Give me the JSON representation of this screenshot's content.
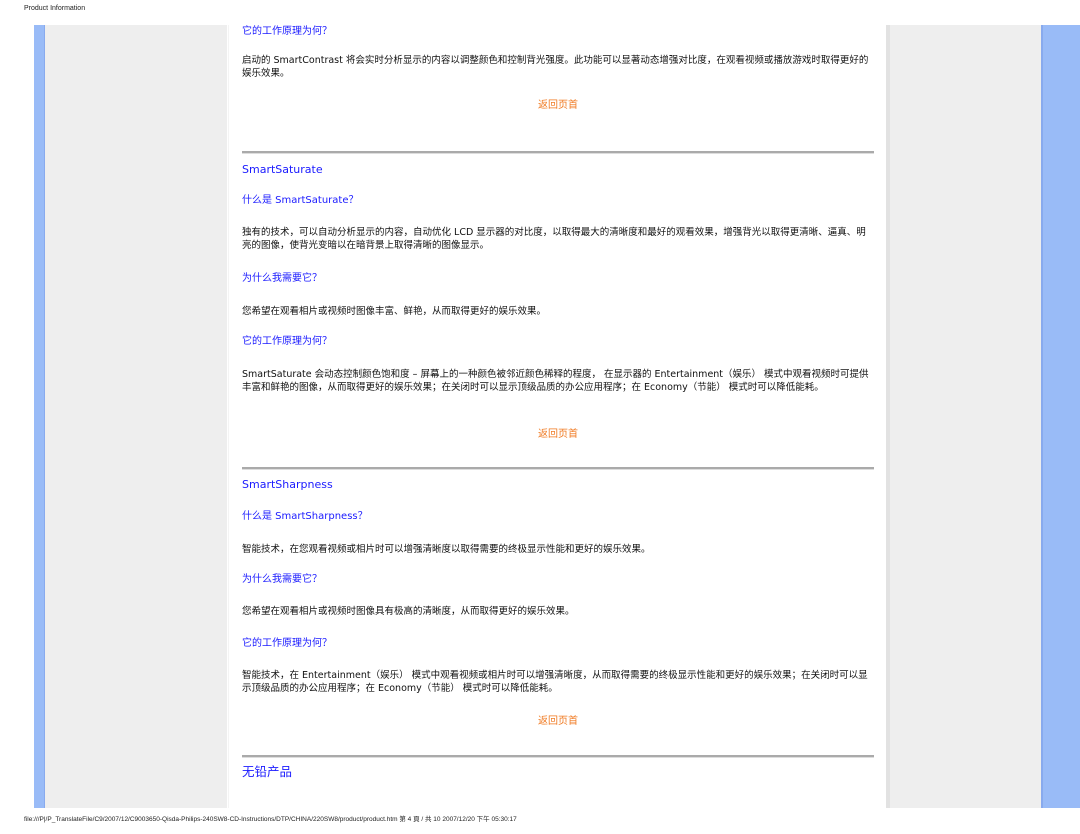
{
  "header": {
    "title": "Product Information"
  },
  "sections": {
    "contrast_tail": {
      "how_heading": "它的工作原理为何？",
      "how_text": "启动的 SmartContrast 将会实时分析显示的内容以调整颜色和控制背光强度。此功能可以显著动态增强对比度，在观看视频或播放游戏时取得更好的娱乐效果。",
      "back_to_top": "返回页首"
    },
    "saturate": {
      "title": "SmartSaturate",
      "what_heading": "什么是 SmartSaturate？",
      "what_text": "独有的技术，可以自动分析显示的内容，自动优化 LCD 显示器的对比度，以取得最大的清晰度和最好的观看效果，增强背光以取得更清晰、逼真、明亮的图像，使背光变暗以在暗背景上取得清晰的图像显示。",
      "why_heading": "为什么我需要它？",
      "why_text": "您希望在观看相片或视频时图像丰富、鲜艳，从而取得更好的娱乐效果。",
      "how_heading": "它的工作原理为何？",
      "how_text": "SmartSaturate 会动态控制颜色饱和度 – 屏幕上的一种颜色被邻近颜色稀释的程度， 在显示器的 Entertainment（娱乐） 模式中观看视频时可提供丰富和鲜艳的图像，从而取得更好的娱乐效果；在关闭时可以显示顶级品质的办公应用程序；在 Economy（节能） 模式时可以降低能耗。",
      "back_to_top": "返回页首"
    },
    "sharpness": {
      "title": "SmartSharpness",
      "what_heading": "什么是 SmartSharpness？",
      "what_text": "智能技术，在您观看视频或相片时可以增强清晰度以取得需要的终极显示性能和更好的娱乐效果。",
      "why_heading": "为什么我需要它？",
      "why_text": "您希望在观看相片或视频时图像具有极高的清晰度，从而取得更好的娱乐效果。",
      "how_heading": "它的工作原理为何？",
      "how_text": "智能技术，在 Entertainment（娱乐） 模式中观看视频或相片时可以增强清晰度，从而取得需要的终极显示性能和更好的娱乐效果；在关闭时可以显示顶级品质的办公应用程序；在 Economy（节能） 模式时可以降低能耗。",
      "back_to_top": "返回页首"
    },
    "lead_free": {
      "title": "无铅产品"
    }
  },
  "footer": {
    "text": "file:///P|/P_TranslateFile/C9/2007/12/C9003650-Qisda-Philips-240SW8-CD-Instructions/DTP/CHINA/220SW8/product/product.htm 第 4 頁 / 共 10 2007/12/20 下午 05:30:17"
  },
  "colors": {
    "heading_blue": "#1a1aff",
    "back_to_top_orange": "#f07a22",
    "side_blue": "#99bbf7",
    "side_gray": "#eeeeee"
  }
}
